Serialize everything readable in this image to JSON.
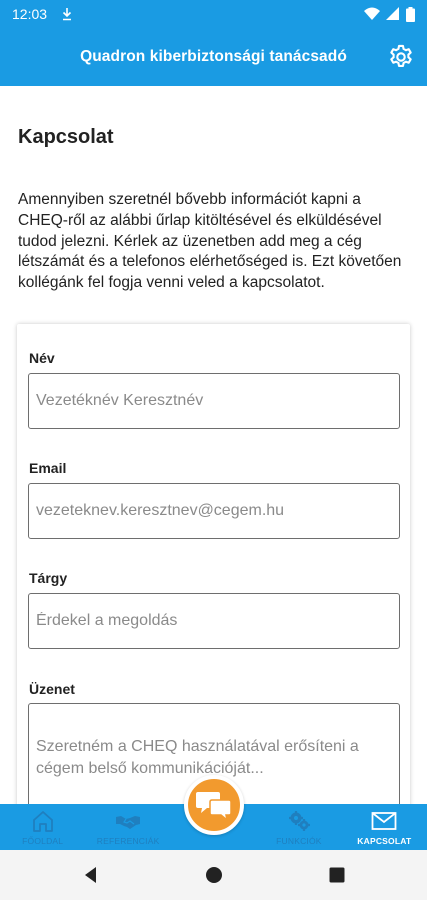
{
  "status_bar": {
    "time": "12:03"
  },
  "app_bar": {
    "title": "Quadron kiberbiztonsági tanácsadó"
  },
  "page": {
    "title": "Kapcsolat",
    "intro": "Amennyiben szeretnél bővebb információt kapni a CHEQ-ről az alábbi űrlap kitöltésével és elküldésével tudod jelezni. Kérlek az üzenetben add meg a cég létszámát és a telefonos elérhetőséged is. Ezt követően kollégánk fel fogja venni veled a kapcsolatot."
  },
  "form": {
    "name": {
      "label": "Név",
      "placeholder": "Vezetéknév Keresztnév",
      "value": ""
    },
    "email": {
      "label": "Email",
      "placeholder": "vezeteknev.keresztnev@cegem.hu",
      "value": ""
    },
    "subject": {
      "label": "Tárgy",
      "placeholder": "Érdekel a megoldás",
      "value": ""
    },
    "message": {
      "label": "Üzenet",
      "placeholder": "Szeretném a CHEQ használatával erősíteni a cégem belső kommunikációját...",
      "value": ""
    }
  },
  "bottom_nav": {
    "items": [
      {
        "label": "FŐOLDAL",
        "icon": "home-icon",
        "active": false
      },
      {
        "label": "REFERENCIÁK",
        "icon": "handshake-icon",
        "active": false
      },
      {
        "label": "FUNKCIÓK",
        "icon": "gears-icon",
        "active": false
      },
      {
        "label": "KAPCSOLAT",
        "icon": "envelope-icon",
        "active": true
      }
    ],
    "fab_icon": "chat-bubbles-icon"
  },
  "colors": {
    "primary": "#1a9be3",
    "accent": "#f29a2e",
    "inactive_nav_label": "#1f7fbf"
  }
}
